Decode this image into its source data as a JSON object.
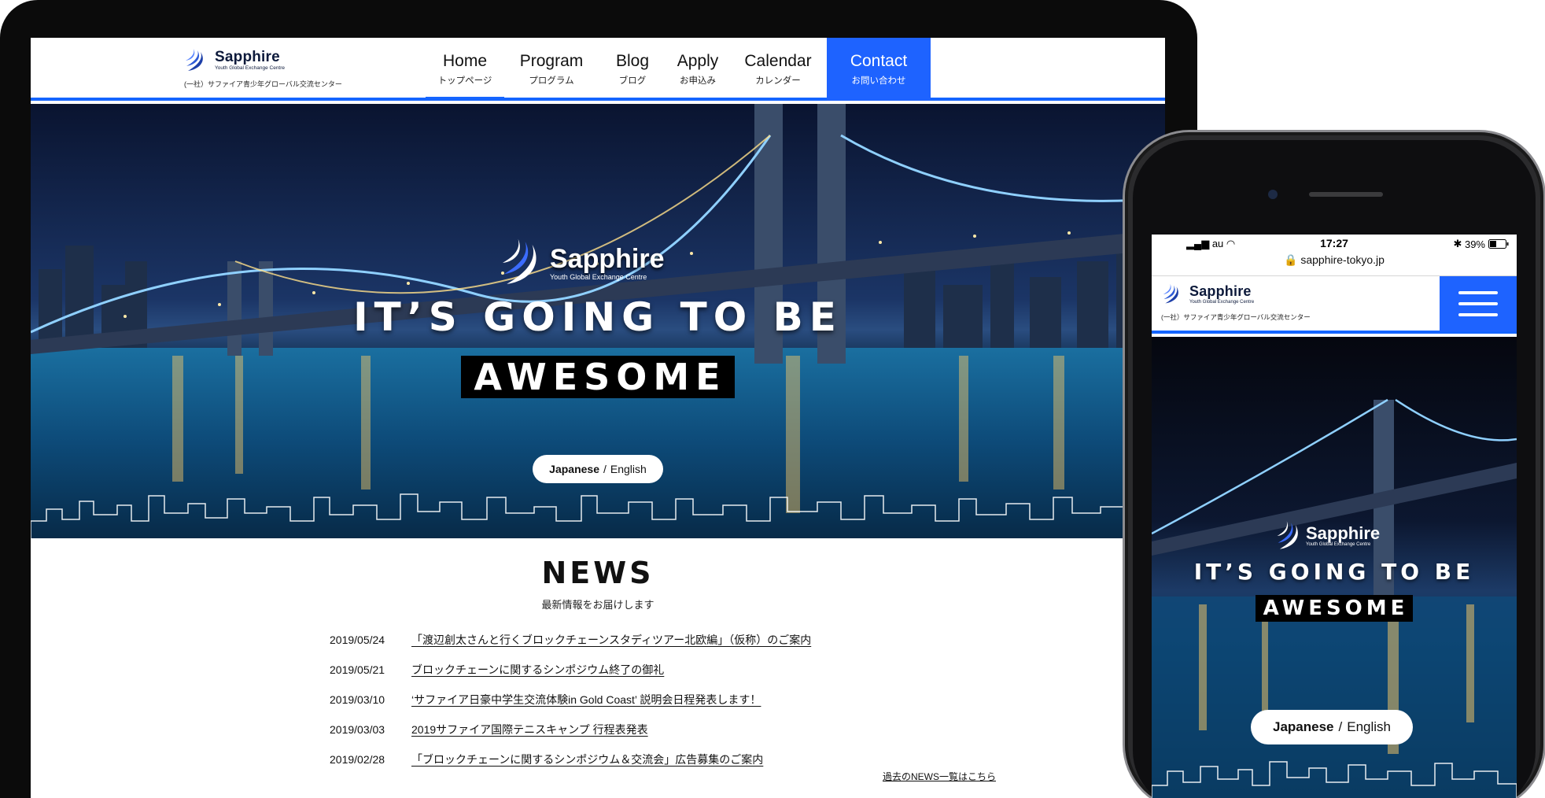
{
  "brand": {
    "name": "Sapphire",
    "tagline": "Youth Global Exchange Centre",
    "subtitle": "(一社）サファイア青少年グローバル交流センター",
    "accent_color": "#1e63ff"
  },
  "nav": {
    "items": [
      {
        "en": "Home",
        "ja": "トップページ"
      },
      {
        "en": "Program",
        "ja": "プログラム"
      },
      {
        "en": "Blog",
        "ja": "ブログ"
      },
      {
        "en": "Apply",
        "ja": "お申込み"
      },
      {
        "en": "Calendar",
        "ja": "カレンダー"
      },
      {
        "en": "Contact",
        "ja": "お問い合わせ"
      }
    ],
    "active": "Home"
  },
  "hero": {
    "line1": "IT’S GOING TO BE",
    "line2": "AWESOME",
    "lang_current": "Japanese",
    "lang_separator": "/",
    "lang_other": "English"
  },
  "news": {
    "title": "NEWS",
    "subtitle": "最新情報をお届けします",
    "items": [
      {
        "date": "2019/05/24",
        "title": "「渡辺創太さんと行くブロックチェーンスタディツアー北欧編」（仮称）のご案内"
      },
      {
        "date": "2019/05/21",
        "title": "ブロックチェーンに関するシンポジウム終了の御礼"
      },
      {
        "date": "2019/03/10",
        "title": "‘サファイア日豪中学生交流体験in Gold Coast’ 説明会日程発表します！"
      },
      {
        "date": "2019/03/03",
        "title": "2019サファイア国際テニスキャンプ 行程表発表"
      },
      {
        "date": "2019/02/28",
        "title": "「ブロックチェーンに関するシンポジウム＆交流会」広告募集のご案内"
      }
    ],
    "more_link": "過去のNEWS一覧はこちら"
  },
  "phone": {
    "carrier": "au",
    "time": "17:27",
    "battery": "39%",
    "url": "sapphire-tokyo.jp",
    "menu_icon": "hamburger-icon"
  }
}
